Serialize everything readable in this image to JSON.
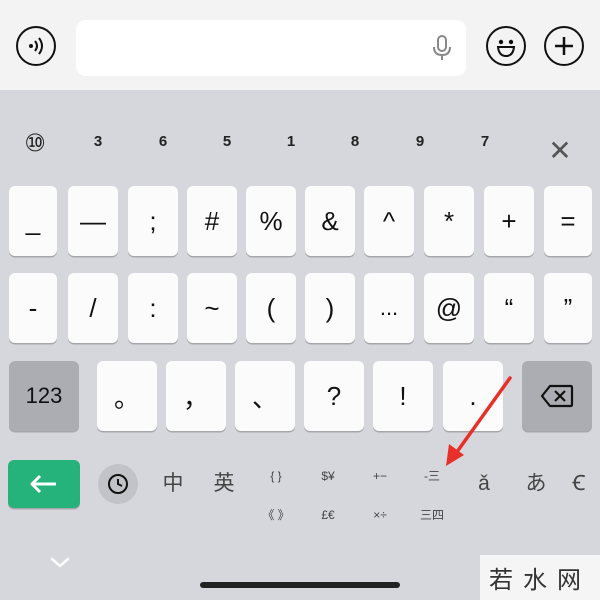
{
  "topbar": {
    "voice_icon": "voice-wave-icon",
    "emoji_icon": "smiley-icon",
    "add_icon": "plus-icon",
    "mic_icon": "microphone-icon",
    "input_value": ""
  },
  "predictions": {
    "first": "⑩",
    "digits": [
      "3",
      "6",
      "5",
      "1",
      "8",
      "9",
      "7"
    ],
    "close_label": "✕"
  },
  "rows": {
    "row1": [
      "_",
      "—",
      ";",
      "#",
      "%",
      "&",
      "^",
      "*",
      "+",
      "="
    ],
    "row2": [
      "-",
      "/",
      ":",
      "~",
      "(",
      ")",
      "...",
      "@",
      "“",
      "”"
    ],
    "row3": [
      "。",
      "，",
      "、",
      "?",
      "!",
      "."
    ],
    "num_key": "123"
  },
  "bottom": {
    "return_icon": "arrow-left-icon",
    "recent_icon": "clock-icon",
    "zh": "中",
    "en": "英",
    "brackets_top": "{ }",
    "brackets_bottom": "《 》",
    "currency_top": "$¥",
    "currency_bottom": "£€",
    "math_top": "+−",
    "math_bottom": "×÷",
    "list_top": "-三",
    "list_bottom": "三四",
    "pinyin": "ǎ",
    "kana": "あ",
    "more": "Ꞓ"
  },
  "watermark": "若水网",
  "colors": {
    "keyboard_bg": "#d6d7dc",
    "key_bg": "#fbfbfb",
    "dark_key_bg": "#abadb2",
    "accent_green": "#26b27b",
    "arrow_red": "#e8302a"
  }
}
